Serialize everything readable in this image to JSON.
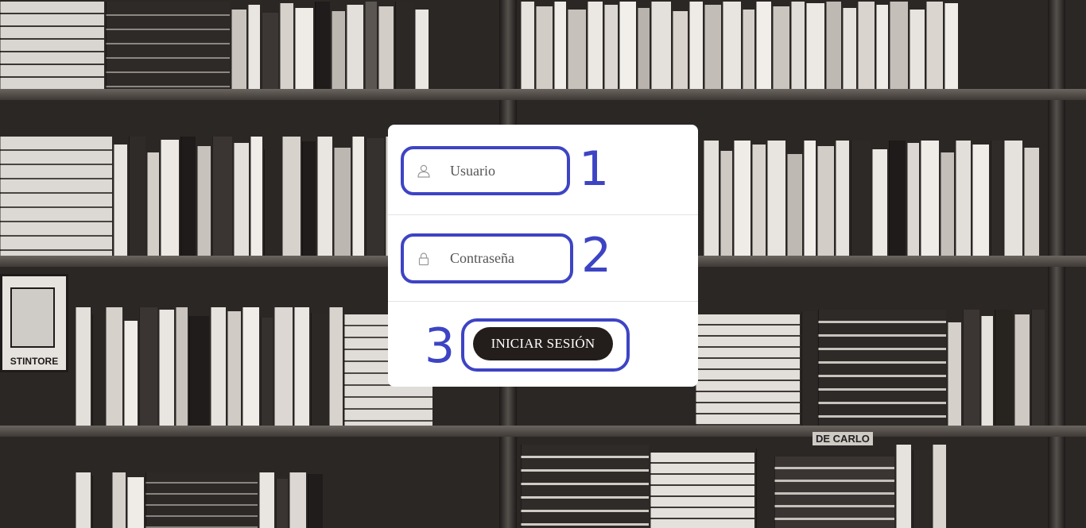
{
  "login": {
    "username_placeholder": "Usuario",
    "password_placeholder": "Contraseña",
    "submit_label": "INICIAR SESIÓN"
  },
  "annotations": {
    "step1": "1",
    "step2": "2",
    "step3": "3"
  },
  "icons": {
    "username": "user-icon",
    "password": "lock-icon"
  },
  "colors": {
    "annotation": "#3d44c4",
    "button": "#231e1c",
    "card": "#ffffff"
  },
  "background": {
    "sign_text": "STINTORE",
    "shelf_label": "DE CARLO"
  }
}
